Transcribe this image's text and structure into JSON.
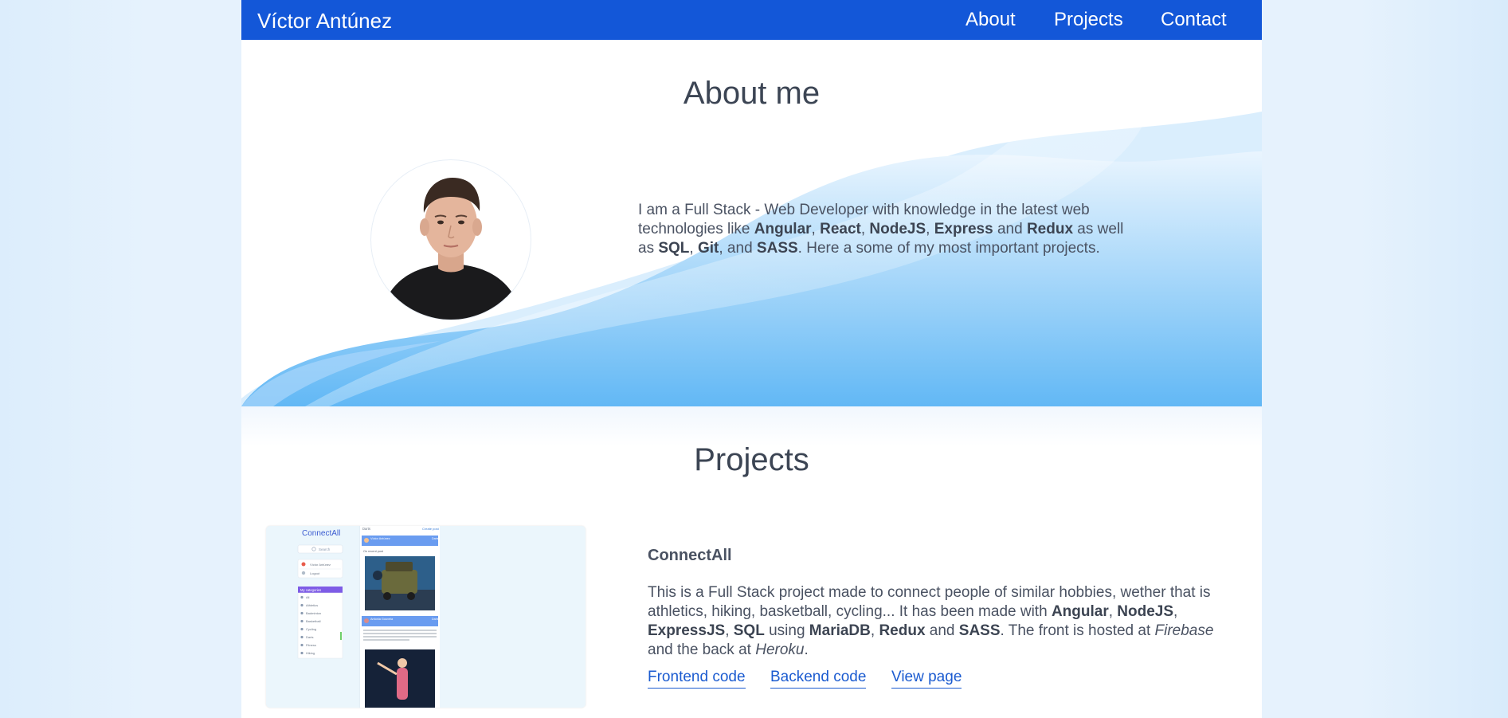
{
  "nav": {
    "brand": "Víctor Antúnez",
    "links": [
      {
        "label": "About"
      },
      {
        "label": "Projects"
      },
      {
        "label": "Contact"
      }
    ]
  },
  "about": {
    "title": "About me",
    "text": [
      {
        "t": "I am a Full Stack - Web Developer with knowledge in the latest web technologies like "
      },
      {
        "t": "Angular",
        "b": true
      },
      {
        "t": ", "
      },
      {
        "t": "React",
        "b": true
      },
      {
        "t": ", "
      },
      {
        "t": "NodeJS",
        "b": true
      },
      {
        "t": ", "
      },
      {
        "t": "Express",
        "b": true
      },
      {
        "t": " and "
      },
      {
        "t": "Redux",
        "b": true
      },
      {
        "t": " as well as "
      },
      {
        "t": "SQL",
        "b": true
      },
      {
        "t": ", "
      },
      {
        "t": "Git",
        "b": true
      },
      {
        "t": ", and "
      },
      {
        "t": "SASS",
        "b": true
      },
      {
        "t": ". Here a some of my most important projects."
      }
    ]
  },
  "projects": {
    "title": "Projects",
    "items": [
      {
        "name": "ConnectAll",
        "description": [
          {
            "t": "This is a Full Stack project made to connect people of similar hobbies, wether that is athletics, hiking, basketball, cycling... It has been made with "
          },
          {
            "t": "Angular",
            "b": true
          },
          {
            "t": ", "
          },
          {
            "t": "NodeJS",
            "b": true
          },
          {
            "t": ", "
          },
          {
            "t": "ExpressJS",
            "b": true
          },
          {
            "t": ", "
          },
          {
            "t": "SQL",
            "b": true
          },
          {
            "t": " using "
          },
          {
            "t": "MariaDB",
            "b": true
          },
          {
            "t": ", "
          },
          {
            "t": "Redux",
            "b": true
          },
          {
            "t": " and "
          },
          {
            "t": "SASS",
            "b": true
          },
          {
            "t": ". The front is hosted at "
          },
          {
            "t": "Firebase",
            "i": true
          },
          {
            "t": " and the back at "
          },
          {
            "t": "Heroku",
            "i": true
          },
          {
            "t": "."
          }
        ],
        "links": [
          {
            "label": "Frontend code"
          },
          {
            "label": "Backend code"
          },
          {
            "label": "View page"
          }
        ],
        "screenshot": {
          "app_title": "ConnectAll",
          "search_placeholder": "Search",
          "menu": [
            "Víctor Antúnez",
            "Logout"
          ],
          "categories_header": "My categories",
          "categories": [
            "All",
            "Athletics",
            "Badminton",
            "Basketball",
            "Cycling",
            "Darts",
            "Fitness",
            "Hiking"
          ],
          "feed_header": "Darts",
          "feed_action": "Create post",
          "posts": [
            {
              "author": "Víctor Antúnez",
              "tag": "Darts",
              "text": "On recent post"
            },
            {
              "author": "Antonia Gouveia",
              "tag": "Darts"
            }
          ]
        }
      }
    ]
  },
  "colors": {
    "nav": "#1357d8",
    "link": "#1b5bd0",
    "wave_light": "#bfe0fb",
    "wave_dark": "#5fb6f4"
  }
}
